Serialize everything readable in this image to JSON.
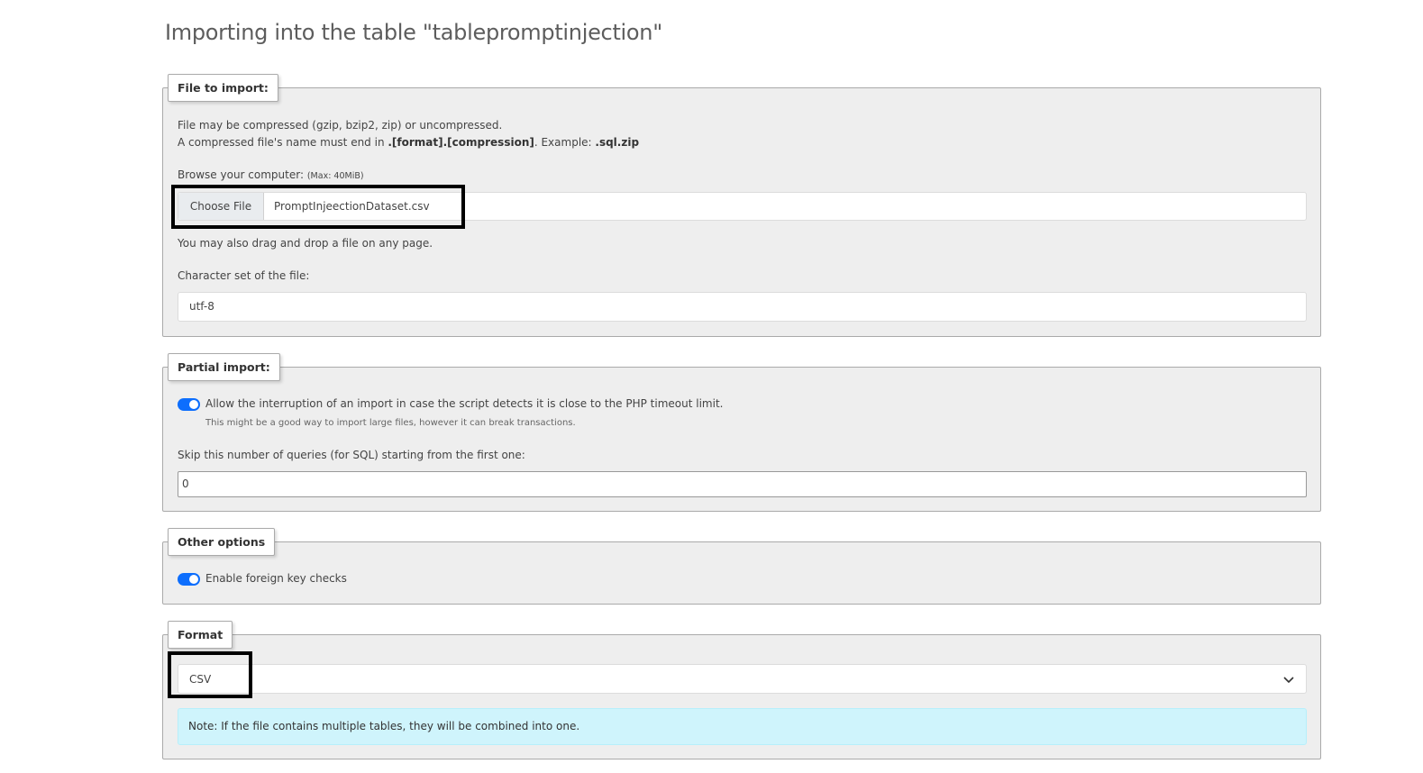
{
  "page_title": "Importing into the table \"tablepromptinjection\"",
  "file_section": {
    "legend": "File to import:",
    "compress_line1": "File may be compressed (gzip, bzip2, zip) or uncompressed.",
    "compress_line2_prefix": "A compressed file's name must end in ",
    "compress_line2_bold": ".[format].[compression]",
    "compress_line2_mid": ". Example: ",
    "compress_line2_example": ".sql.zip",
    "browse_label": "Browse your computer:",
    "browse_max": "(Max: 40MiB)",
    "choose_button": "Choose File",
    "file_name": "PromptInjeectionDataset.csv",
    "drag_hint": "You may also drag and drop a file on any page.",
    "charset_label": "Character set of the file:",
    "charset_value": "utf-8"
  },
  "partial_section": {
    "legend": "Partial import:",
    "allow_label": "Allow the interruption of an import in case the script detects it is close to the PHP timeout limit.",
    "allow_enabled": true,
    "allow_hint": "This might be a good way to import large files, however it can break transactions.",
    "skip_label": "Skip this number of queries (for SQL) starting from the first one:",
    "skip_value": "0"
  },
  "other_section": {
    "legend": "Other options",
    "fk_label": "Enable foreign key checks",
    "fk_enabled": true
  },
  "format_section": {
    "legend": "Format",
    "selected_format": "CSV",
    "note": "Note: If the file contains multiple tables, they will be combined into one."
  },
  "colors": {
    "toggle_on": "#0d6efd",
    "note_bg": "#cff4fc",
    "panel_bg": "#eeeeee"
  }
}
